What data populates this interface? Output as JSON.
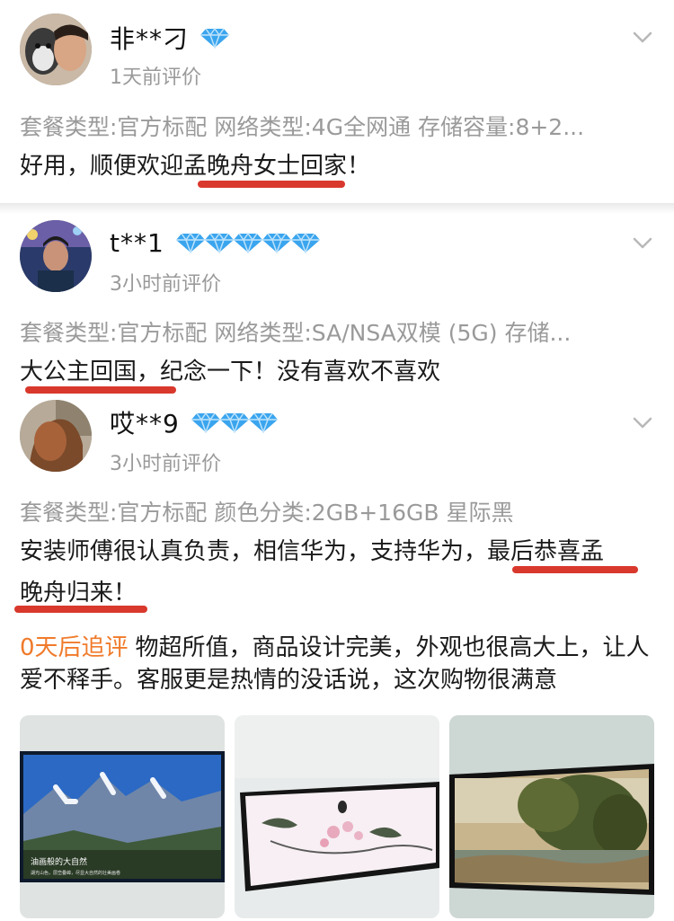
{
  "reviews": [
    {
      "username": "非**刁",
      "diamonds": 1,
      "time": "1天前评价",
      "spec": "套餐类型:官方标配  网络类型:4G全网通  存储容量:8+2...",
      "content": "好用，顺便欢迎孟晚舟女士回家！"
    },
    {
      "username": "t**1",
      "diamonds": 5,
      "time": "3小时前评价",
      "spec": "套餐类型:官方标配  网络类型:SA/NSA双模 (5G)  存储...",
      "content": "大公主回国，纪念一下！没有喜欢不喜欢"
    },
    {
      "username": "哎**9",
      "diamonds": 3,
      "time": "3小时前评价",
      "spec": "套餐类型:官方标配  颜色分类:2GB+16GB 星际黑",
      "content_line1": "安装师傅很认真负责，相信华为，支持华为，最后恭喜孟",
      "content_line2": "晚舟归来！",
      "followup_tag": "0天后追评",
      "followup_text": "物超所值，商品设计完美，外观也很高大上，让人爱不释手。客服更是热情的没话说，这次购物很满意",
      "photos": [
        {
          "caption_title": "油画般的大自然",
          "caption_sub": "湖光山色，层峦叠嶂，尽显大自然的壮美画卷"
        },
        {
          "caption_title": "",
          "caption_sub": ""
        },
        {
          "caption_title": "",
          "caption_sub": ""
        }
      ]
    }
  ],
  "colors": {
    "diamond": "#3aa5ee",
    "underline": "#d9382c",
    "followup_tag": "#f07a2a",
    "muted": "#9a9a9a"
  }
}
